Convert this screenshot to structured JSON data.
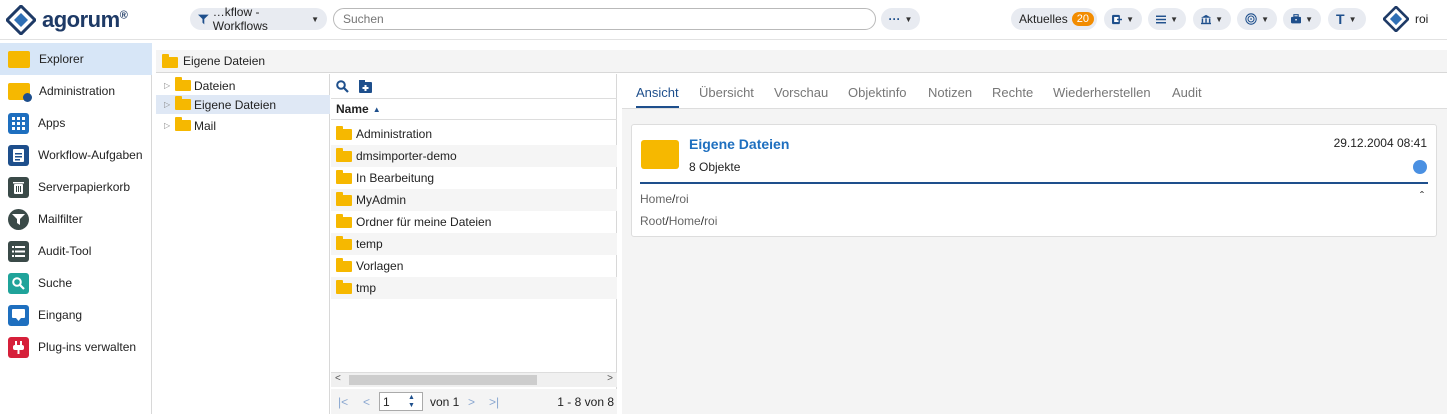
{
  "app": {
    "logo_text": "agorum",
    "logo_mark": "®"
  },
  "header": {
    "workflow_filter": "…kflow - Workflows",
    "search_placeholder": "Suchen",
    "more": "···",
    "aktuelles_label": "Aktuelles",
    "aktuelles_count": "20",
    "text_tool": "T",
    "user": "roi"
  },
  "sidebar": {
    "items": [
      {
        "label": "Explorer",
        "icon": "folder-icon"
      },
      {
        "label": "Administration",
        "icon": "admin-folder-icon"
      },
      {
        "label": "Apps",
        "icon": "apps-grid-icon"
      },
      {
        "label": "Workflow-Aufgaben",
        "icon": "clipboard-icon"
      },
      {
        "label": "Serverpapierkorb",
        "icon": "trash-icon"
      },
      {
        "label": "Mailfilter",
        "icon": "funnel-icon"
      },
      {
        "label": "Audit-Tool",
        "icon": "list-icon"
      },
      {
        "label": "Suche",
        "icon": "search-icon"
      },
      {
        "label": "Eingang",
        "icon": "inbox-icon"
      },
      {
        "label": "Plug-ins verwalten",
        "icon": "plug-icon"
      }
    ]
  },
  "breadcrumb": "Eigene Dateien",
  "tree": {
    "items": [
      "Dateien",
      "Eigene Dateien",
      "Mail"
    ]
  },
  "list": {
    "column_name": "Name",
    "rows": [
      "Administration",
      "dmsimporter-demo",
      "In Bearbeitung",
      "MyAdmin",
      "Ordner für meine Dateien",
      "temp",
      "Vorlagen",
      "tmp"
    ],
    "pager": {
      "page": "1",
      "of_label": "von 1",
      "range": "1 - 8 von 8"
    }
  },
  "detail": {
    "tabs": [
      "Ansicht",
      "Übersicht",
      "Vorschau",
      "Objektinfo",
      "Notizen",
      "Rechte",
      "Wiederherstellen",
      "Audit"
    ],
    "title": "Eigene Dateien",
    "date": "29.12.2004 08:41",
    "objects": "8 Objekte",
    "path1": {
      "a": "Home",
      "sep": "/",
      "b": "roi"
    },
    "path2": {
      "a": "Root",
      "sep1": "/",
      "b": "Home",
      "sep2": "/",
      "c": "roi"
    }
  },
  "colors": {
    "accent": "#1e4f8c",
    "folder": "#f6b800",
    "badge": "#f28c00",
    "sidebar_active": "#d7e6f7"
  }
}
